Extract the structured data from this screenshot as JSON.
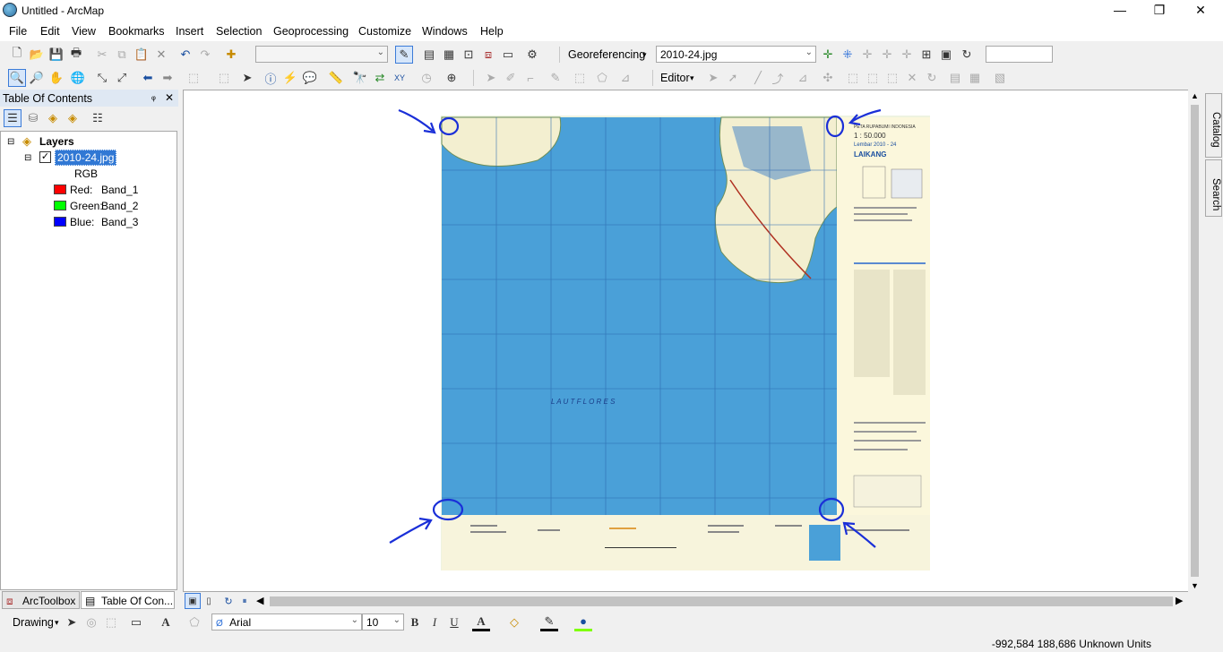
{
  "window": {
    "title": "Untitled - ArcMap",
    "minimize": "—",
    "maximize": "❐",
    "close": "✕"
  },
  "menu": [
    "File",
    "Edit",
    "View",
    "Bookmarks",
    "Insert",
    "Selection",
    "Geoprocessing",
    "Customize",
    "Windows",
    "Help"
  ],
  "georef_toolbar": {
    "label": "Georeferencing",
    "layer_value": "2010-24.jpg",
    "scale_value": ""
  },
  "editor_toolbar": {
    "label": "Editor"
  },
  "toc": {
    "title": "Table Of Contents",
    "pin": "ᵩ",
    "close": "✕",
    "root": "Layers",
    "layer": {
      "name": "2010-24.jpg",
      "checked": true,
      "renderer": "RGB",
      "bands": [
        {
          "label": "Red:",
          "band": "Band_1",
          "color": "#ff0000"
        },
        {
          "label": "Green:",
          "band": "Band_2",
          "color": "#00ff00"
        },
        {
          "label": "Blue:",
          "band": "Band_3",
          "color": "#0000ff"
        }
      ]
    }
  },
  "bottom_tabs": [
    "ArcToolbox",
    "Table Of Con..."
  ],
  "right_dock": [
    "Catalog",
    "Search"
  ],
  "drawing_toolbar": {
    "label": "Drawing",
    "font": "Arial",
    "size": "10",
    "bold": "B",
    "italic": "I",
    "underline": "U"
  },
  "map": {
    "sheet_lines": [
      "PETA RUPABUMI INDONESIA",
      "1 : 50.000",
      "Lembar 2010 - 24",
      "LAIKANG"
    ],
    "sea_label": "L A U T   F L O R E S",
    "colors": {
      "sea": "#4aa0d8",
      "land": "#f3efd0",
      "annotation": "#1a2fd8"
    }
  },
  "status": {
    "coords": "-992,584  188,686 Unknown Units"
  }
}
